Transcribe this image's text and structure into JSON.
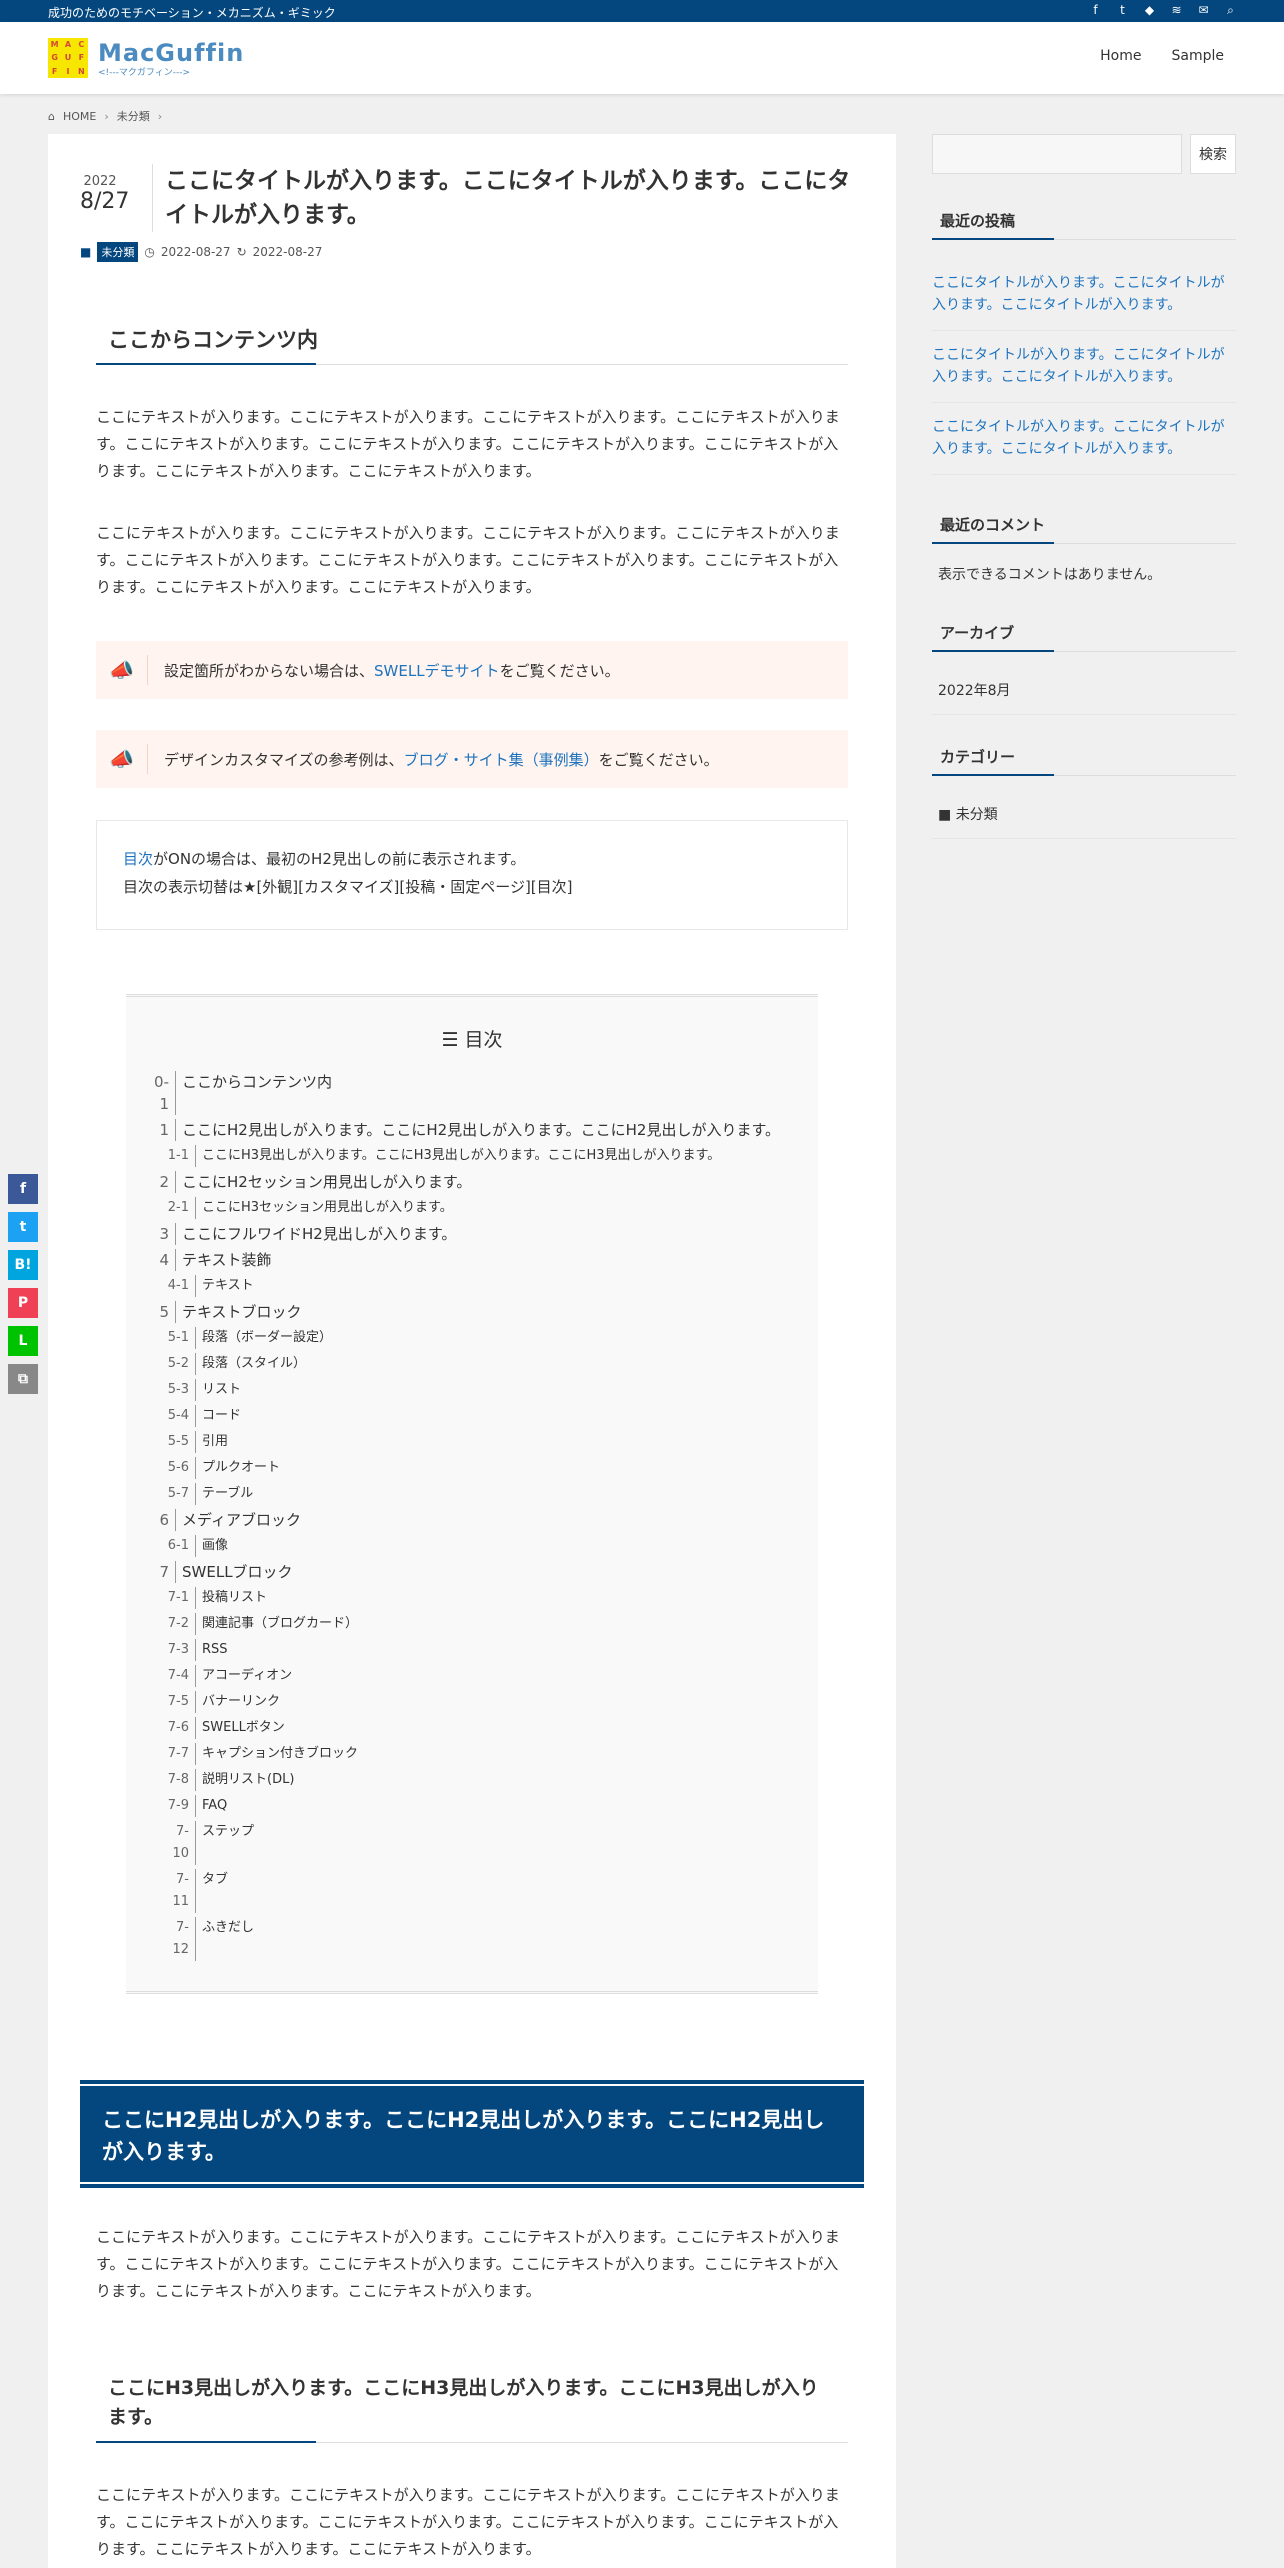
{
  "topbar": {
    "tagline": "成功のためのモチベーション・メカニズム・ギミック",
    "icons": [
      "f",
      "t",
      "◆",
      "≋",
      "✉",
      "⌕"
    ]
  },
  "logo": {
    "letters": [
      "M",
      "A",
      "C",
      "G",
      "U",
      "F",
      "F",
      "I",
      "N"
    ],
    "title": "MacGuffin",
    "subtitle": "<!---マクガフィン--->"
  },
  "nav": {
    "home": "Home",
    "sample": "Sample"
  },
  "breadcrumb": {
    "home": "HOME",
    "category": "未分類"
  },
  "post": {
    "year": "2022",
    "day": "8/27",
    "title": "ここにタイトルが入ります。ここにタイトルが入ります。ここにタイトルが入ります。",
    "category": "未分類",
    "published": "2022-08-27",
    "modified": "2022-08-27",
    "heading_content": "ここからコンテンツ内",
    "para1": "ここにテキストが入ります。ここにテキストが入ります。ここにテキストが入ります。ここにテキストが入ります。ここにテキストが入ります。ここにテキストが入ります。ここにテキストが入ります。ここにテキストが入ります。ここにテキストが入ります。ここにテキストが入ります。",
    "para2": "ここにテキストが入ります。ここにテキストが入ります。ここにテキストが入ります。ここにテキストが入ります。ここにテキストが入ります。ここにテキストが入ります。ここにテキストが入ります。ここにテキストが入ります。ここにテキストが入ります。ここにテキストが入ります。",
    "cap1_pre": "設定箇所がわからない場合は、",
    "cap1_link": "SWELLデモサイト",
    "cap1_post": "をご覧ください。",
    "cap2_pre": "デザインカスタマイズの参考例は、",
    "cap2_link": "ブログ・サイト集（事例集）",
    "cap2_post": "をご覧ください。",
    "note_link": "目次",
    "note_line1": "がONの場合は、最初のH2見出しの前に表示されます。",
    "note_line2": "目次の表示切替は★[外観][カスタマイズ][投稿・固定ページ][目次]",
    "h2_box": "ここにH2見出しが入ります。ここにH2見出しが入ります。ここにH2見出しが入ります。",
    "para3": "ここにテキストが入ります。ここにテキストが入ります。ここにテキストが入ります。ここにテキストが入ります。ここにテキストが入ります。ここにテキストが入ります。ここにテキストが入ります。ここにテキストが入ります。ここにテキストが入ります。ここにテキストが入ります。",
    "h3": "ここにH3見出しが入ります。ここにH3見出しが入ります。ここにH3見出しが入ります。",
    "para4": "ここにテキストが入ります。ここにテキストが入ります。ここにテキストが入ります。ここにテキストが入ります。ここにテキストが入ります。ここにテキストが入ります。ここにテキストが入ります。ここにテキストが入ります。ここにテキストが入ります。ここにテキストが入ります。"
  },
  "toc": {
    "title": "目次",
    "items": [
      {
        "num": "0-1",
        "label": "ここからコンテンツ内",
        "level": 1
      },
      {
        "num": "1",
        "label": "ここにH2見出しが入ります。ここにH2見出しが入ります。ここにH2見出しが入ります。",
        "level": 1
      },
      {
        "num": "1-1",
        "label": "ここにH3見出しが入ります。ここにH3見出しが入ります。ここにH3見出しが入ります。",
        "level": 2
      },
      {
        "num": "2",
        "label": "ここにH2セッション用見出しが入ります。",
        "level": 1
      },
      {
        "num": "2-1",
        "label": "ここにH3セッション用見出しが入ります。",
        "level": 2
      },
      {
        "num": "3",
        "label": "ここにフルワイドH2見出しが入ります。",
        "level": 1
      },
      {
        "num": "4",
        "label": "テキスト装飾",
        "level": 1
      },
      {
        "num": "4-1",
        "label": "テキスト",
        "level": 2
      },
      {
        "num": "5",
        "label": "テキストブロック",
        "level": 1
      },
      {
        "num": "5-1",
        "label": "段落（ボーダー設定）",
        "level": 2
      },
      {
        "num": "5-2",
        "label": "段落（スタイル）",
        "level": 2
      },
      {
        "num": "5-3",
        "label": "リスト",
        "level": 2
      },
      {
        "num": "5-4",
        "label": "コード",
        "level": 2
      },
      {
        "num": "5-5",
        "label": "引用",
        "level": 2
      },
      {
        "num": "5-6",
        "label": "プルクオート",
        "level": 2
      },
      {
        "num": "5-7",
        "label": "テーブル",
        "level": 2
      },
      {
        "num": "6",
        "label": "メディアブロック",
        "level": 1
      },
      {
        "num": "6-1",
        "label": "画像",
        "level": 2
      },
      {
        "num": "7",
        "label": "SWELLブロック",
        "level": 1
      },
      {
        "num": "7-1",
        "label": "投稿リスト",
        "level": 2
      },
      {
        "num": "7-2",
        "label": "関連記事（ブログカード）",
        "level": 2
      },
      {
        "num": "7-3",
        "label": "RSS",
        "level": 2
      },
      {
        "num": "7-4",
        "label": "アコーディオン",
        "level": 2
      },
      {
        "num": "7-5",
        "label": "バナーリンク",
        "level": 2
      },
      {
        "num": "7-6",
        "label": "SWELLボタン",
        "level": 2
      },
      {
        "num": "7-7",
        "label": "キャプション付きブロック",
        "level": 2
      },
      {
        "num": "7-8",
        "label": "説明リスト(DL)",
        "level": 2
      },
      {
        "num": "7-9",
        "label": "FAQ",
        "level": 2
      },
      {
        "num": "7-10",
        "label": "ステップ",
        "level": 2
      },
      {
        "num": "7-11",
        "label": "タブ",
        "level": 2
      },
      {
        "num": "7-12",
        "label": "ふきだし",
        "level": 2
      }
    ]
  },
  "sidebar": {
    "search_button": "検索",
    "recent_title": "最近の投稿",
    "recent": [
      "ここにタイトルが入ります。ここにタイトルが入ります。ここにタイトルが入ります。",
      "ここにタイトルが入ります。ここにタイトルが入ります。ここにタイトルが入ります。",
      "ここにタイトルが入ります。ここにタイトルが入ります。ここにタイトルが入ります。"
    ],
    "comments_title": "最近のコメント",
    "comments_empty": "表示できるコメントはありません。",
    "archive_title": "アーカイブ",
    "archive_item": "2022年8月",
    "category_title": "カテゴリー",
    "category_item": "未分類"
  },
  "share": {
    "labels": [
      "f",
      "t",
      "B!",
      "P",
      "L",
      "⧉"
    ],
    "colors": [
      "#3b5998",
      "#1da1f2",
      "#00a4de",
      "#ef4056",
      "#00c300",
      "#888888"
    ]
  },
  "colors": {
    "main": "#04467e",
    "link": "#1e73be",
    "cap_bg": "#fff4ef"
  }
}
